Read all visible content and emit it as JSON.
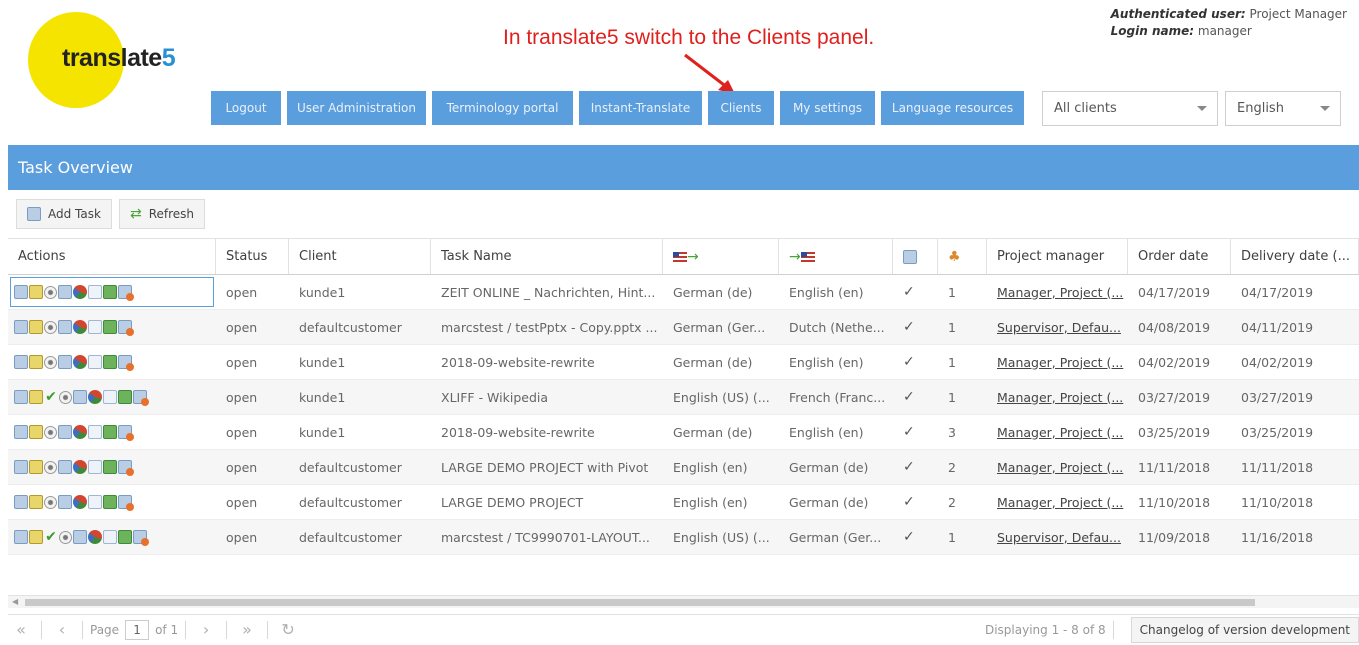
{
  "logo": {
    "text_main": "translate",
    "text_accent": "5"
  },
  "annotation": "In translate5 switch to the Clients panel.",
  "auth": {
    "user_label": "Authenticated user:",
    "user_value": "Project Manager",
    "login_label": "Login name:",
    "login_value": "manager"
  },
  "nav": {
    "logout": "Logout",
    "user_admin": "User Administration",
    "terminology": "Terminology portal",
    "instant_translate": "Instant-Translate",
    "clients": "Clients",
    "my_settings": "My settings",
    "language_resources": "Language resources"
  },
  "client_select": "All clients",
  "language_select": "English",
  "panel": {
    "title": "Task Overview",
    "add_task": "Add Task",
    "refresh": "Refresh"
  },
  "columns": {
    "actions": "Actions",
    "status": "Status",
    "client": "Client",
    "task_name": "Task Name",
    "project_manager": "Project manager",
    "order_date": "Order date",
    "delivery_date": "Delivery date (..."
  },
  "rows": [
    {
      "extra_check": false,
      "status": "open",
      "client": "kunde1",
      "task": "ZEIT ONLINE _ Nachrichten, Hint...",
      "src": "German (de)",
      "tgt": "English (en)",
      "num": "1",
      "pm": "Manager, Project (...",
      "order": "04/17/2019",
      "delivery": "04/17/2019"
    },
    {
      "extra_check": false,
      "status": "open",
      "client": "defaultcustomer",
      "task": "marcstest / testPptx - Copy.pptx ...",
      "src": "German (Ger...",
      "tgt": "Dutch (Nethe...",
      "num": "1",
      "pm": "Supervisor, Defau...",
      "order": "04/08/2019",
      "delivery": "04/11/2019"
    },
    {
      "extra_check": false,
      "status": "open",
      "client": "kunde1",
      "task": "2018-09-website-rewrite",
      "src": "German (de)",
      "tgt": "English (en)",
      "num": "1",
      "pm": "Manager, Project (...",
      "order": "04/02/2019",
      "delivery": "04/02/2019"
    },
    {
      "extra_check": true,
      "status": "open",
      "client": "kunde1",
      "task": "XLIFF - Wikipedia",
      "src": "English (US) (...",
      "tgt": "French (Franc...",
      "num": "1",
      "pm": "Manager, Project (...",
      "order": "03/27/2019",
      "delivery": "03/27/2019"
    },
    {
      "extra_check": false,
      "status": "open",
      "client": "kunde1",
      "task": "2018-09-website-rewrite",
      "src": "German (de)",
      "tgt": "English (en)",
      "num": "3",
      "pm": "Manager, Project (...",
      "order": "03/25/2019",
      "delivery": "03/25/2019"
    },
    {
      "extra_check": false,
      "status": "open",
      "client": "defaultcustomer",
      "task": "LARGE DEMO PROJECT with Pivot",
      "src": "English (en)",
      "tgt": "German (de)",
      "num": "2",
      "pm": "Manager, Project (...",
      "order": "11/11/2018",
      "delivery": "11/11/2018"
    },
    {
      "extra_check": false,
      "status": "open",
      "client": "defaultcustomer",
      "task": "LARGE DEMO PROJECT",
      "src": "English (en)",
      "tgt": "German (de)",
      "num": "2",
      "pm": "Manager, Project (...",
      "order": "11/10/2018",
      "delivery": "11/10/2018"
    },
    {
      "extra_check": true,
      "status": "open",
      "client": "defaultcustomer",
      "task": "marcstest / TC9990701-LAYOUT...",
      "src": "English (US) (...",
      "tgt": "German (Ger...",
      "num": "1",
      "pm": "Supervisor, Defau...",
      "order": "11/09/2018",
      "delivery": "11/16/2018"
    }
  ],
  "pager": {
    "page_label": "Page",
    "page_value": "1",
    "of_label": "of 1",
    "displaying": "Displaying 1 - 8 of 8",
    "changelog": "Changelog of version development"
  },
  "colors": {
    "accent": "#5b9ede",
    "logo_yellow": "#f5e400",
    "annotation_red": "#e0201d"
  }
}
